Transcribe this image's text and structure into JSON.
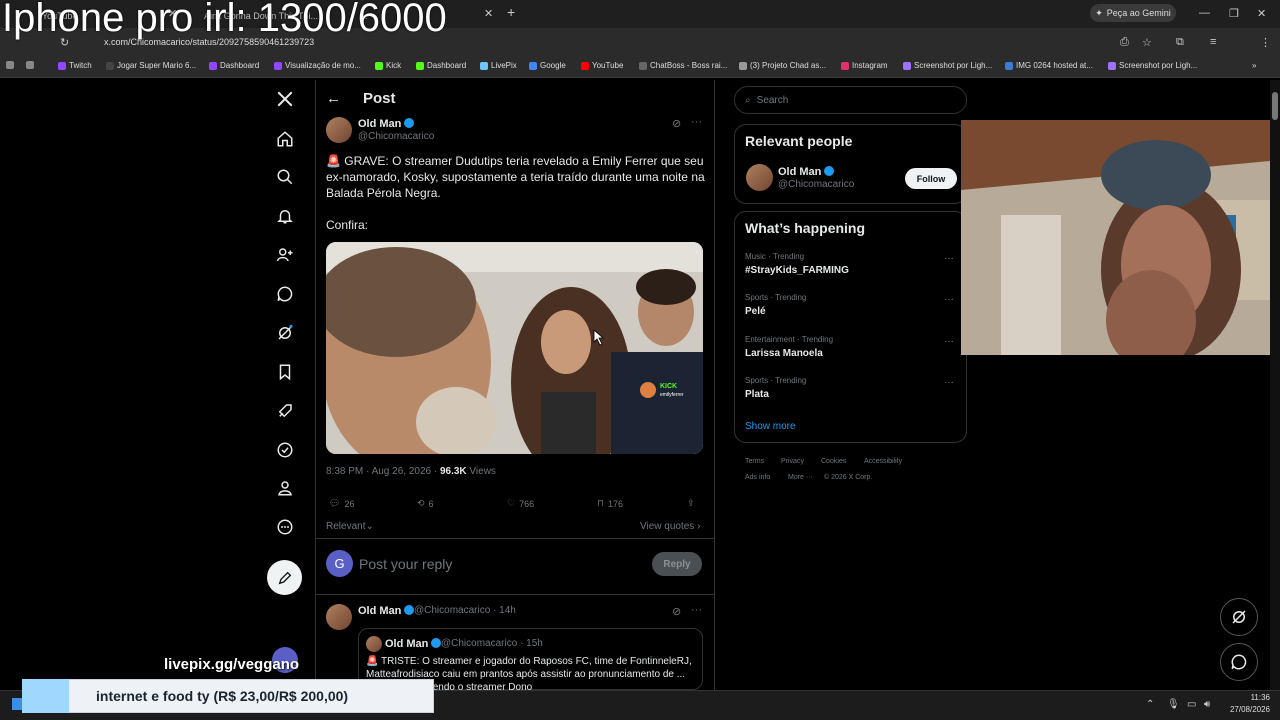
{
  "overlay": {
    "title": "Iphone pro irl: 1300/6000",
    "livepix": "livepix.gg/veggano",
    "donation_text": "internet e food ty (R$ 23,00/R$ 200,00)",
    "donation_progress": 0.115
  },
  "browser": {
    "tabs": [
      {
        "label": "YouTube"
      },
      {
        "label": "Ain't Gonna Down This Thi..."
      },
      {
        "label": "..."
      }
    ],
    "gemini_label": "Peça ao Gemini",
    "url": "x.com/Chicomacarico/status/2092758590461239723",
    "bookmarks": [
      {
        "label": "Twitch"
      },
      {
        "label": "Jogar Super Mario 6..."
      },
      {
        "label": "Dashboard"
      },
      {
        "label": "Visualização de mo..."
      },
      {
        "label": "Kick"
      },
      {
        "label": "Dashboard"
      },
      {
        "label": "LivePix"
      },
      {
        "label": "Google"
      },
      {
        "label": "YouTube"
      },
      {
        "label": "ChatBoss - Boss rai..."
      },
      {
        "label": "(3) Projeto Chad as..."
      },
      {
        "label": "Instagram"
      },
      {
        "label": "Screenshot por Ligh..."
      },
      {
        "label": "IMG 0264 hosted at..."
      },
      {
        "label": "Screenshot por Ligh..."
      }
    ]
  },
  "post": {
    "header": "Post",
    "author_name": "Old Man",
    "author_handle": "@Chicomacarico",
    "text_1": "🚨 GRAVE: O streamer Dudutips teria revelado a Emily Ferrer que seu ex-namorado, Kosky, supostamente a teria traído durante uma noite na Balada Pérola Negra.",
    "text_2": "Confira:",
    "media_kick_label": "KICK",
    "media_kick_user": "emilyferrer",
    "time": "8:38 PM · Aug 26, 2026 · ",
    "views_count": "96.3K",
    "views_label": " Views",
    "replies": "26",
    "reposts": "6",
    "likes": "766",
    "bookmarks": "176",
    "relevant": "Relevant",
    "view_quotes": "View quotes",
    "reply_avatar": "G",
    "reply_placeholder": "Post your reply",
    "reply_button": "Reply"
  },
  "reply_post": {
    "author_name": "Old Man",
    "author_handle": "@Chicomacarico",
    "age": "· 14h",
    "quote_author_name": "Old Man",
    "quote_author_handle": "@Chicomacarico",
    "quote_age": "· 15h",
    "quote_text": "🚨 TRISTE: O streamer e jogador do Raposos FC, time de FontinneleRJ, Matteafrodisiaco caiu em prantos após assistir ao pronunciamento de ... punição envolvendo o streamer Dono"
  },
  "sidebar": {
    "search_placeholder": "Search",
    "relevant_title": "Relevant people",
    "person_name": "Old Man",
    "person_handle": "@Chicomacarico",
    "follow_label": "Follow",
    "happening_title": "What’s happening",
    "trends": [
      {
        "category": "Music · Trending",
        "name": "#StrayKids_FARMING"
      },
      {
        "category": "Sports · Trending",
        "name": "Pelé"
      },
      {
        "category": "Entertainment · Trending",
        "name": "Larissa Manoela"
      },
      {
        "category": "Sports · Trending",
        "name": "Plata"
      }
    ],
    "show_more": "Show more",
    "footer": [
      "Terms",
      "Privacy",
      "Cookies",
      "Accessibility",
      "Ads info",
      "More ···",
      "© 2026 X Corp."
    ]
  },
  "taskbar": {
    "time": "11:36",
    "date": "27/08/2026"
  },
  "colors": {
    "accent": "#1d9bf0",
    "background": "#000000",
    "border": "#2f3336",
    "muted": "#71767b"
  }
}
